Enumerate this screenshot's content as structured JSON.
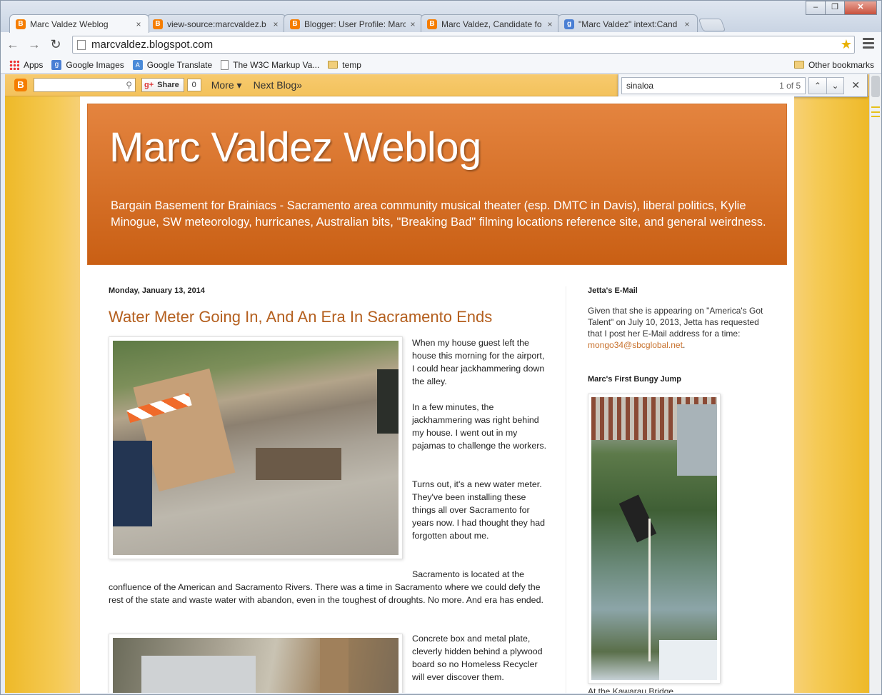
{
  "window": {
    "tabs": [
      {
        "title": "Marc Valdez Weblog",
        "icon": "blogger-icon",
        "active": true
      },
      {
        "title": "view-source:marcvaldez.b",
        "icon": "blogger-icon",
        "active": false
      },
      {
        "title": "Blogger: User Profile: Marc",
        "icon": "blogger-icon",
        "active": false
      },
      {
        "title": "Marc Valdez, Candidate fo",
        "icon": "blogger-icon",
        "active": false
      },
      {
        "title": "\"Marc Valdez\" intext:Cand",
        "icon": "google-icon",
        "active": false
      }
    ],
    "close_glyph": "×"
  },
  "toolbar": {
    "url": "marcvaldez.blogspot.com"
  },
  "bookmarks": {
    "items": [
      {
        "label": "Apps",
        "icon": "apps-icon"
      },
      {
        "label": "Google Images",
        "icon": "google-icon"
      },
      {
        "label": "Google Translate",
        "icon": "translate-icon"
      },
      {
        "label": "The W3C Markup Va...",
        "icon": "page-icon"
      },
      {
        "label": "temp",
        "icon": "folder-icon"
      }
    ],
    "other": "Other bookmarks"
  },
  "blogger_bar": {
    "share_label": "Share",
    "share_count": "0",
    "more_label": "More",
    "next_blog_label": "Next Blog»"
  },
  "find_bar": {
    "query": "sinaloa",
    "count": "1 of 5"
  },
  "blog": {
    "title": "Marc Valdez Weblog",
    "description": "Bargain Basement for Brainiacs - Sacramento area community musical theater (esp. DMTC in Davis), liberal politics, Kylie Minogue, SW meteorology, hurricanes, Australian bits, \"Breaking Bad\" filming locations reference site, and general weirdness."
  },
  "post": {
    "date": "Monday, January 13, 2014",
    "title": "Water Meter Going In, And An Era In Sacramento Ends",
    "para1": "When my house guest left the house this morning for the airport, I could hear jackhammering down the alley.",
    "para2": "In a few minutes, the jackhammering was right behind my house. I went out in my pajamas to challenge the workers.",
    "para3": "Turns out, it's a new water meter. They've been installing these things all over Sacramento for years now. I had thought they had forgotten about me.",
    "para4": "Sacramento is located at the confluence of the American and Sacramento Rivers. There was a time in Sacramento where we could defy the rest of the state and waste water with abandon, even in the toughest of droughts. No more.  And era has ended.",
    "para5": "Concrete box and metal plate, cleverly hidden behind a plywood board so no Homeless Recycler will ever discover them."
  },
  "sidebar": {
    "jetta_title": "Jetta's E-Mail",
    "jetta_text": "Given that she is appearing on \"America's Got Talent\" on July 10, 2013, Jetta has requested that I post her E-Mail address for a time: ",
    "jetta_email": "mongo34@sbcglobal.net",
    "jetta_tail": ".",
    "bungy_title": "Marc's First Bungy Jump",
    "bungy_caption": "At the Kawarau Bridge"
  }
}
